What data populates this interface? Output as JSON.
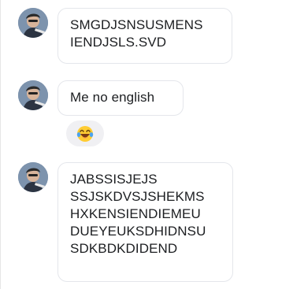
{
  "messages": [
    {
      "text": "SMGDJSNSUSMENS\nIENDJSLS.SVD"
    },
    {
      "text": "Me no english"
    },
    {
      "text": "JABSSISJEJS\nSSJSKDVSJSHEKMS\nHXKENSIENDIEMEU\nDUEYEUKSDHIDNSU\nSDKBDKDIDEND"
    }
  ],
  "reaction": {
    "icon": "laughing-tears-emoji"
  }
}
